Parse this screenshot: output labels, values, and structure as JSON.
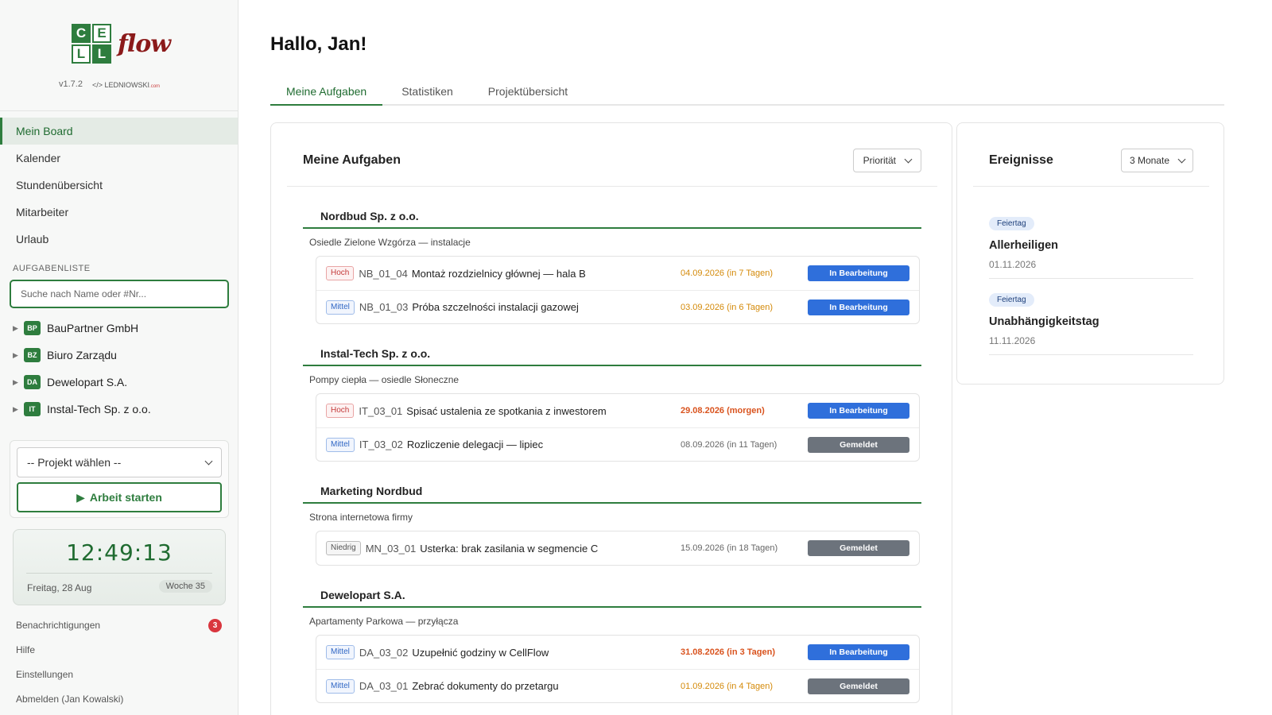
{
  "brand": {
    "logo_letters": [
      "C",
      "E",
      "L",
      "L"
    ],
    "logo_suffix": "flow",
    "version": "v1.7.2",
    "author": "</> LEDNIOWSKI",
    "author_domain": ".com",
    "accent_color": "#2e7d3e"
  },
  "nav": [
    {
      "label": "Mein Board",
      "active": true
    },
    {
      "label": "Kalender"
    },
    {
      "label": "Stundenübersicht"
    },
    {
      "label": "Mitarbeiter"
    },
    {
      "label": "Urlaub"
    }
  ],
  "tasklist": {
    "label": "AUFGABENLISTE",
    "search_placeholder": "Suche nach Name oder #Nr...",
    "companies": [
      {
        "badge": "BP",
        "name": "BauPartner GmbH"
      },
      {
        "badge": "BZ",
        "name": "Biuro Zarządu"
      },
      {
        "badge": "DA",
        "name": "Dewelopart S.A."
      },
      {
        "badge": "IT",
        "name": "Instal-Tech Sp. z o.o."
      }
    ]
  },
  "project_panel": {
    "select_value": "-- Projekt wählen --",
    "start_label": "Arbeit starten"
  },
  "clock": {
    "time": "12:49:13",
    "date": "Freitag, 28 Aug",
    "week": "Woche 35"
  },
  "bottom_links": {
    "notifications": "Benachrichtigungen",
    "notifications_count": "3",
    "help": "Hilfe",
    "settings": "Einstellungen",
    "logout": "Abmelden (Jan Kowalski)"
  },
  "main": {
    "greeting": "Hallo, Jan!",
    "tabs": [
      {
        "label": "Meine Aufgaben",
        "active": true
      },
      {
        "label": "Statistiken"
      },
      {
        "label": "Projektübersicht"
      }
    ]
  },
  "tasks": {
    "title": "Meine Aufgaben",
    "sort_value": "Priorität",
    "groups": [
      {
        "company": "Nordbud Sp. z o.o.",
        "project": "Osiedle Zielone Wzgórza — instalacje",
        "items": [
          {
            "prio": "Hoch",
            "code": "NB_01_04",
            "title": "Montaż rozdzielnicy głównej — hala B",
            "date": "04.09.2026 (in 7 Tagen)",
            "status": "In Bearbeitung"
          },
          {
            "prio": "Mittel",
            "code": "NB_01_03",
            "title": "Próba szczelności instalacji gazowej",
            "date": "03.09.2026 (in 6 Tagen)",
            "status": "In Bearbeitung"
          }
        ]
      },
      {
        "company": "Instal-Tech Sp. z o.o.",
        "project": "Pompy ciepła — osiedle Słoneczne",
        "items": [
          {
            "prio": "Hoch",
            "code": "IT_03_01",
            "title": "Spisać ustalenia ze spotkania z inwestorem",
            "date": "29.08.2026 (morgen)",
            "status": "In Bearbeitung"
          },
          {
            "prio": "Mittel",
            "code": "IT_03_02",
            "title": "Rozliczenie delegacji — lipiec",
            "date": "08.09.2026 (in 11 Tagen)",
            "status": "Gemeldet"
          }
        ]
      },
      {
        "company": "Marketing Nordbud",
        "project": "Strona internetowa firmy",
        "items": [
          {
            "prio": "Niedrig",
            "code": "MN_03_01",
            "title": "Usterka: brak zasilania w segmencie C",
            "date": "15.09.2026 (in 18 Tagen)",
            "status": "Gemeldet"
          }
        ]
      },
      {
        "company": "Dewelopart S.A.",
        "project": "Apartamenty Parkowa — przyłącza",
        "items": [
          {
            "prio": "Mittel",
            "code": "DA_03_02",
            "title": "Uzupełnić godziny w CellFlow",
            "date": "31.08.2026 (in 3 Tagen)",
            "status": "In Bearbeitung"
          },
          {
            "prio": "Mittel",
            "code": "DA_03_01",
            "title": "Zebrać dokumenty do przetargu",
            "date": "01.09.2026 (in 4 Tagen)",
            "status": "Gemeldet"
          }
        ]
      }
    ]
  },
  "events": {
    "title": "Ereignisse",
    "range_value": "3 Monate",
    "items": [
      {
        "tag": "Feiertag",
        "name": "Allerheiligen",
        "date": "01.11.2026"
      },
      {
        "tag": "Feiertag",
        "name": "Unabhängigkeitstag",
        "date": "11.11.2026"
      }
    ]
  }
}
